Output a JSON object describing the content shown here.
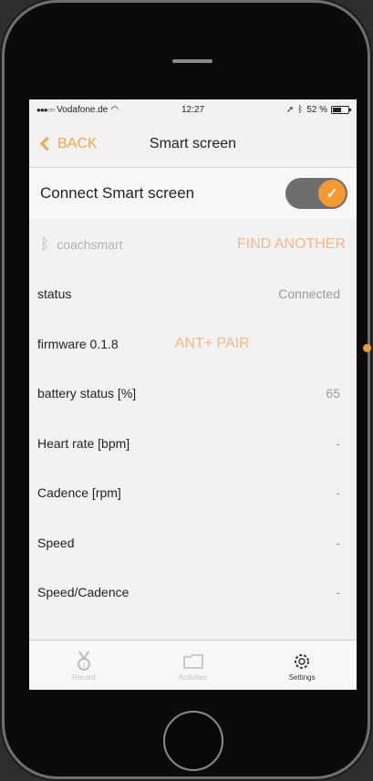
{
  "status_bar": {
    "carrier": "Vodafone.de",
    "time": "12:27",
    "battery": "52 %"
  },
  "nav": {
    "back_label": "BACK",
    "title": "Smart screen"
  },
  "connect": {
    "label": "Connect Smart screen",
    "toggle_on": true,
    "check": "✓"
  },
  "device": {
    "name": "coachsmart",
    "find_another": "FIND ANOTHER"
  },
  "rows": [
    {
      "label": "status",
      "value": "Connected"
    },
    {
      "label": "firmware 0.1.8",
      "value": "",
      "action": "ANT+ PAIR"
    },
    {
      "label": "battery status [%]",
      "value": "65"
    },
    {
      "label": "Heart rate [bpm]",
      "value": "-"
    },
    {
      "label": "Cadence [rpm]",
      "value": "-"
    },
    {
      "label": "Speed",
      "value": "-"
    },
    {
      "label": "Speed/Cadence",
      "value": "-"
    }
  ],
  "tabs": [
    {
      "label": "Record",
      "icon": "medal-icon"
    },
    {
      "label": "Activities",
      "icon": "folder-icon"
    },
    {
      "label": "Settings",
      "icon": "gear-icon"
    }
  ],
  "colors": {
    "accent": "#f39a32",
    "accent_light": "#f7b886",
    "toggle_track": "#6d6d6d"
  }
}
